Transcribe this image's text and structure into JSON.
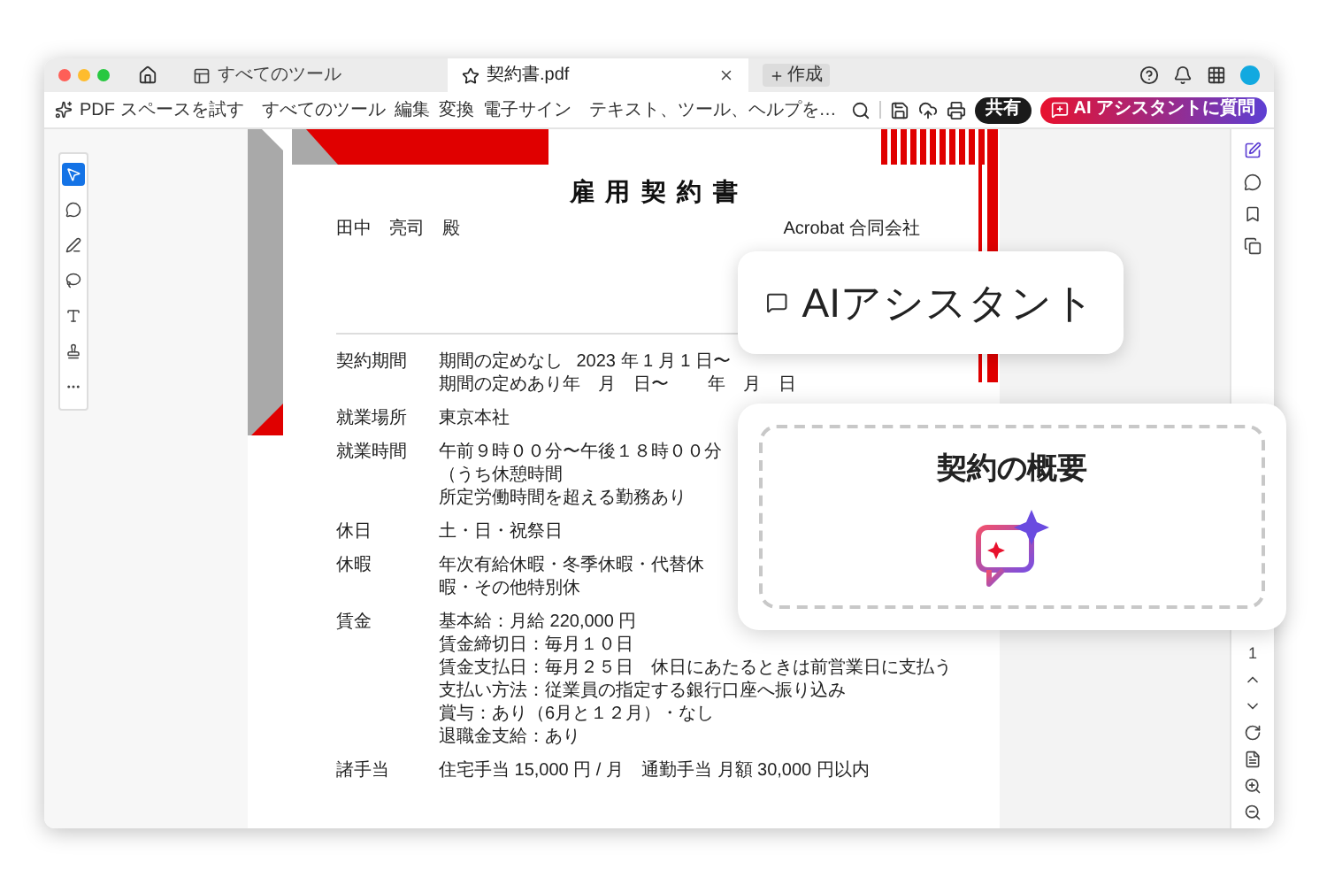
{
  "title_bar": {
    "tabs": [
      {
        "label": "すべてのツール",
        "selected": false
      },
      {
        "label": "契約書.pdf",
        "selected": true
      }
    ],
    "new_button": "作成"
  },
  "toolbar": {
    "try_button": "PDF スペースを試す",
    "menu": [
      "すべてのツール",
      "編集",
      "変換",
      "電子サイン"
    ],
    "search": {
      "placeholder": "テキスト、ツール、ヘルプを…"
    },
    "share_button": "共有",
    "ai_button": "AI アシスタントに質問"
  },
  "left_tools": [
    {
      "kind": "select",
      "selected": true
    },
    {
      "kind": "comment",
      "selected": false
    },
    {
      "kind": "pen",
      "selected": false
    },
    {
      "kind": "lasso",
      "selected": false
    },
    {
      "kind": "text",
      "selected": false
    },
    {
      "kind": "stamp",
      "selected": false
    },
    {
      "kind": "more",
      "selected": false
    }
  ],
  "document": {
    "title": "雇用契約書",
    "recipient": "田中　亮司　殿",
    "company": "Acrobat 合同会社",
    "rows": [
      {
        "kind": "columns",
        "label": "契約期間",
        "lines": [
          [
            "期間の定めなし",
            "2023 年 1 月 1 日〜"
          ],
          [
            "期間の定めあり",
            "年　月　日〜",
            "年　月　日"
          ]
        ]
      },
      {
        "kind": "text",
        "label": "就業場所",
        "lines": [
          "東京本社"
        ]
      },
      {
        "kind": "text",
        "label": "就業時間",
        "lines": [
          "午前９時００分〜午後１８時００分（うち休憩時間",
          "所定労働時間を超える勤務あり"
        ]
      },
      {
        "kind": "text",
        "label": "休日",
        "lines": [
          "土・日・祝祭日"
        ]
      },
      {
        "kind": "text",
        "label": "休暇",
        "lines": [
          "年次有給休暇・冬季休暇・代替休暇・その他特別休"
        ]
      },
      {
        "kind": "text",
        "label": "賃金",
        "lines": [
          "基本給：月給 220,000 円",
          "賃金締切日：毎月１０日",
          "賃金支払日：毎月２５日　休日にあたるときは前営業日に支払う",
          "支払い方法：従業員の指定する銀行口座へ振り込み",
          "賞与：あり（6月と１２月）・なし",
          "退職金支給：あり"
        ]
      },
      {
        "kind": "text",
        "label": "諸手当",
        "lines": [
          "住宅手当 15,000 円 / 月　通勤手当 月額 30,000 円以内"
        ]
      }
    ]
  },
  "right_rail": {
    "page_number": "1"
  },
  "ai_panel": {
    "title": "AIアシスタント"
  },
  "summary_card": {
    "title": "契約の概要"
  }
}
